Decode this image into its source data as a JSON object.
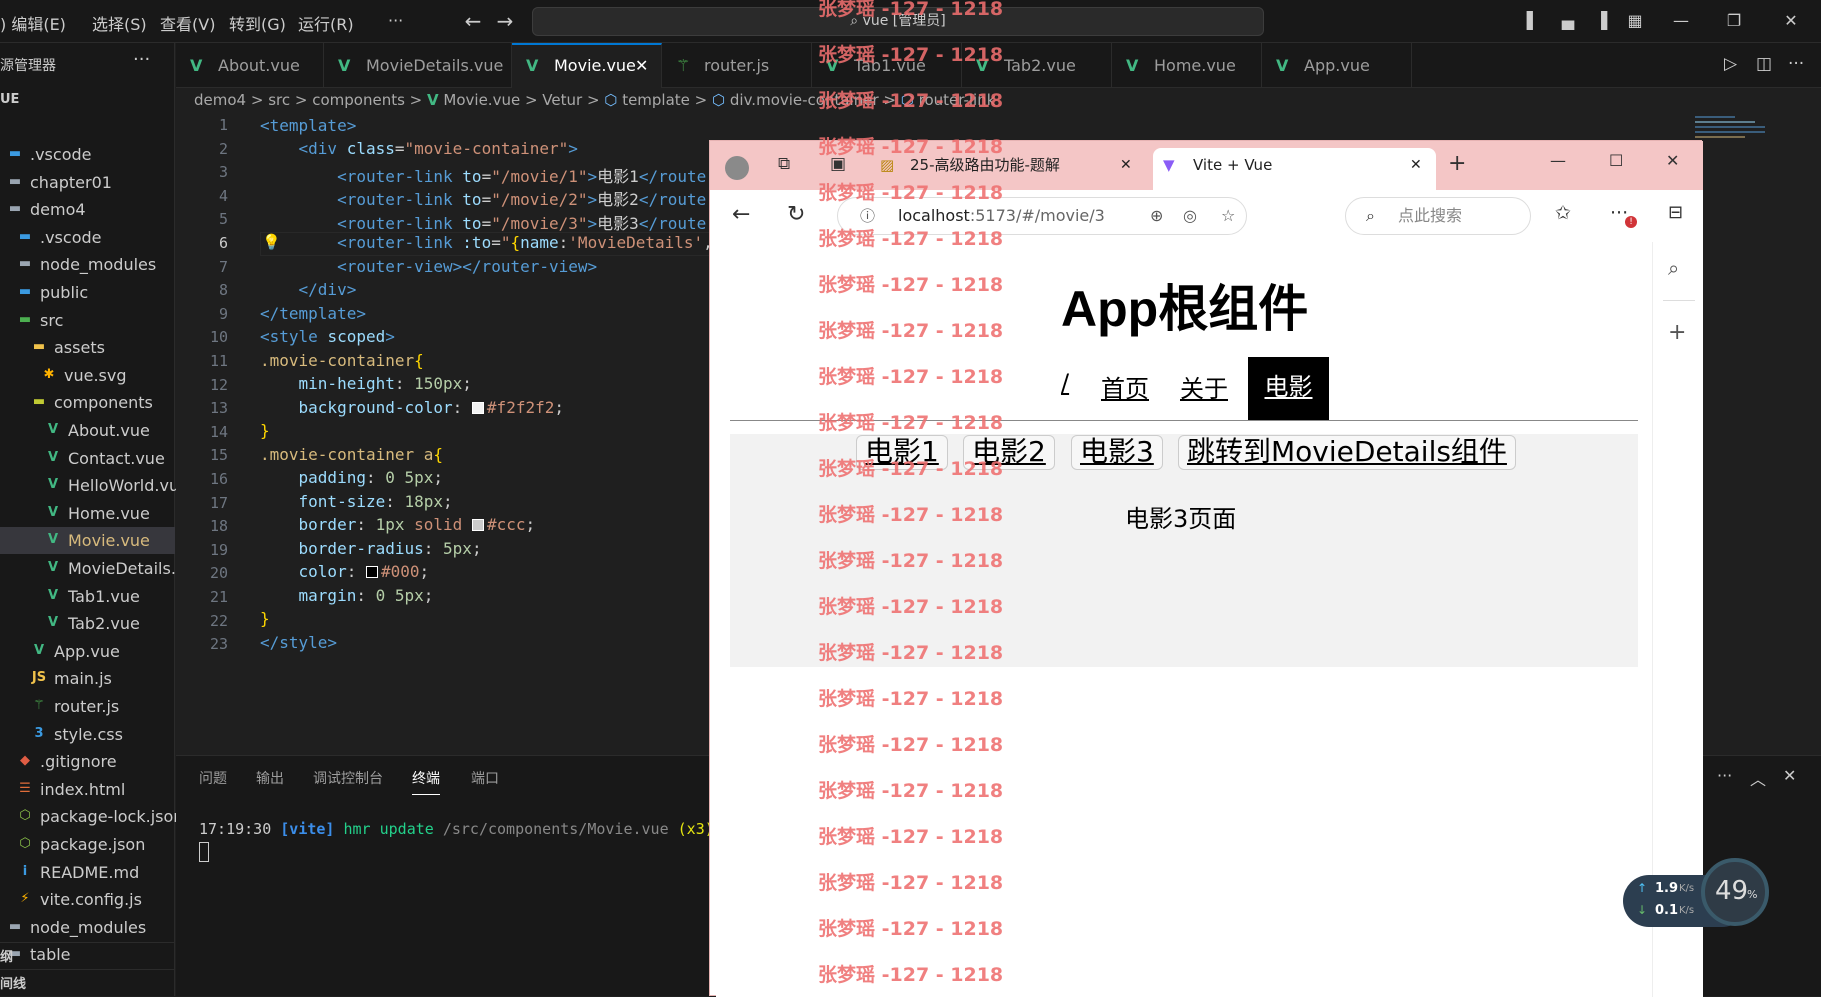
{
  "titlebar": {
    "menu": [
      "编辑(E)",
      "选择(S)",
      "查看(V)",
      "转到(G)",
      "运行(R)",
      "···"
    ],
    "command_center": "vue [管理员]"
  },
  "sidebar": {
    "header": "源管理器",
    "section": "UE",
    "items": [
      {
        "label": ".vscode",
        "icon": "vscode-folder-icon"
      },
      {
        "label": "chapter01",
        "icon": "folder-icon"
      },
      {
        "label": "demo4",
        "icon": "folder-open-icon"
      },
      {
        "label": ".vscode",
        "icon": "vscode-folder-icon"
      },
      {
        "label": "node_modules",
        "icon": "folder-icon"
      },
      {
        "label": "public",
        "icon": "public-folder-icon"
      },
      {
        "label": "src",
        "icon": "src-folder-icon"
      },
      {
        "label": "assets",
        "icon": "assets-folder-icon"
      },
      {
        "label": "vue.svg",
        "icon": "svg-file-icon"
      },
      {
        "label": "components",
        "icon": "components-folder-icon"
      },
      {
        "label": "About.vue",
        "icon": "vue-file-icon"
      },
      {
        "label": "Contact.vue",
        "icon": "vue-file-icon"
      },
      {
        "label": "HelloWorld.vue",
        "icon": "vue-file-icon"
      },
      {
        "label": "Home.vue",
        "icon": "vue-file-icon"
      },
      {
        "label": "Movie.vue",
        "icon": "vue-file-icon"
      },
      {
        "label": "MovieDetails....",
        "icon": "vue-file-icon"
      },
      {
        "label": "Tab1.vue",
        "icon": "vue-file-icon"
      },
      {
        "label": "Tab2.vue",
        "icon": "vue-file-icon"
      },
      {
        "label": "App.vue",
        "icon": "vue-file-icon"
      },
      {
        "label": "main.js",
        "icon": "js-file-icon"
      },
      {
        "label": "router.js",
        "icon": "router-file-icon"
      },
      {
        "label": "style.css",
        "icon": "css-file-icon"
      },
      {
        "label": ".gitignore",
        "icon": "git-file-icon"
      },
      {
        "label": "index.html",
        "icon": "html-file-icon"
      },
      {
        "label": "package-lock.json",
        "icon": "node-file-icon"
      },
      {
        "label": "package.json",
        "icon": "node-file-icon"
      },
      {
        "label": "README.md",
        "icon": "info-file-icon"
      },
      {
        "label": "vite.config.js",
        "icon": "vite-file-icon"
      },
      {
        "label": "node_modules",
        "icon": "folder-icon"
      },
      {
        "label": "table",
        "icon": "folder-icon"
      }
    ],
    "outline": "纲",
    "timeline": "间线"
  },
  "tabs": [
    {
      "label": "About.vue"
    },
    {
      "label": "MovieDetails.vue"
    },
    {
      "label": "Movie.vue"
    },
    {
      "label": "router.js"
    },
    {
      "label": "Tab1.vue"
    },
    {
      "label": "Tab2.vue"
    },
    {
      "label": "Home.vue"
    },
    {
      "label": "App.vue"
    }
  ],
  "breadcrumb": [
    "demo4",
    "src",
    "components",
    "Movie.vue",
    "Vetur",
    "template",
    "div.movie-container",
    "router-link"
  ],
  "editor": {
    "line_numbers": [
      "1",
      "2",
      "3",
      "4",
      "5",
      "6",
      "7",
      "8",
      "9",
      "10",
      "11",
      "12",
      "13",
      "14",
      "15",
      "16",
      "17",
      "18",
      "19",
      "20",
      "21",
      "22",
      "23"
    ],
    "current_line": "6"
  },
  "panel": {
    "tabs": [
      "问题",
      "输出",
      "调试控制台",
      "终端",
      "端口"
    ],
    "terminal_time": "17:19:30",
    "terminal_tag": "[vite]",
    "terminal_msg": "hmr update",
    "terminal_path": "/src/components/Movie.vue",
    "terminal_count": "(x3)"
  },
  "browser": {
    "tab1_title": "25-高级路由功能-题解",
    "tab2_title": "Vite + Vue",
    "url_host": "localhost",
    "url_rest": ":5173/#/movie/3",
    "search_placeholder": "点此搜索",
    "page": {
      "heading": "App根组件",
      "nav": [
        "/",
        "首页",
        "关于",
        "电影"
      ],
      "movie_links": [
        "电影1",
        "电影2",
        "电影3",
        "跳转到MovieDetails组件"
      ],
      "content": "电影3页面"
    }
  },
  "watermark": "张梦瑶 -127 - 1218",
  "speed": {
    "up": "1.9",
    "down": "0.1",
    "unit": "K/s",
    "gauge": "49",
    "gauge_unit": "%"
  }
}
